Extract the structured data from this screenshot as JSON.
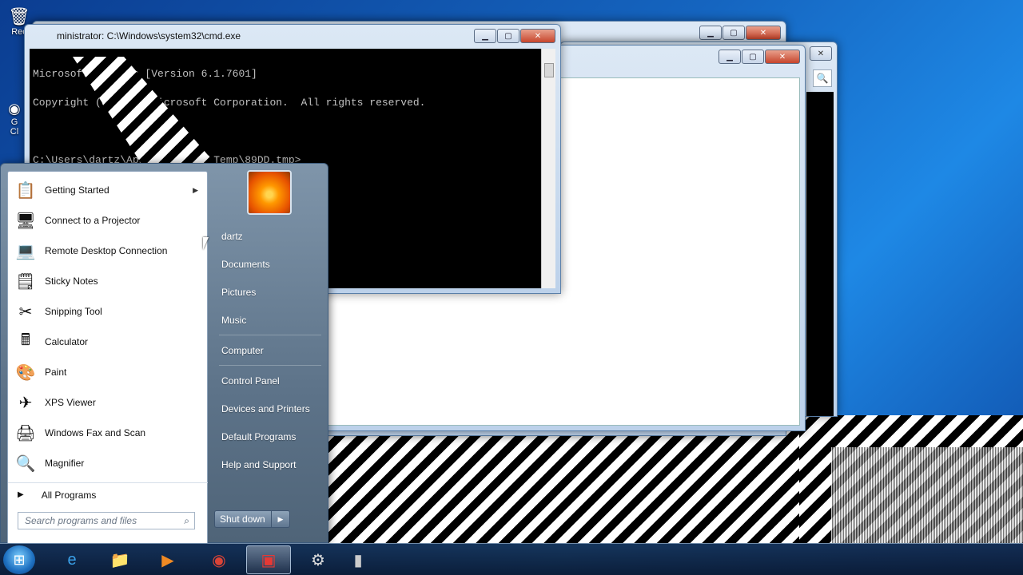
{
  "desktop": {
    "icon_recycle": "Rec",
    "icon_chrome": "G\nCl"
  },
  "cmd_window": {
    "title": "ministrator: C:\\Windows\\system32\\cmd.exe",
    "lines": [
      "Microsoft Windows [Version 6.1.7601]",
      "Copyright (c) 2009 Microsoft Corporation.  All rights reserved.",
      "",
      "C:\\Users\\dartz\\AppData\\Local\\Temp\\89DD.tmp>_"
    ]
  },
  "start_menu": {
    "programs": [
      {
        "label": "Getting Started",
        "icon": "getting-started-icon",
        "glyph": "📋",
        "submenu": true
      },
      {
        "label": "Connect to a Projector",
        "icon": "projector-icon",
        "glyph": "🖥"
      },
      {
        "label": "Remote Desktop Connection",
        "icon": "remote-desktop-icon",
        "glyph": "💻"
      },
      {
        "label": "Sticky Notes",
        "icon": "sticky-notes-icon",
        "glyph": "🗒"
      },
      {
        "label": "Snipping Tool",
        "icon": "snipping-tool-icon",
        "glyph": "✂"
      },
      {
        "label": "Calculator",
        "icon": "calculator-icon",
        "glyph": "🖩"
      },
      {
        "label": "Paint",
        "icon": "paint-icon",
        "glyph": "🎨"
      },
      {
        "label": "XPS Viewer",
        "icon": "xps-viewer-icon",
        "glyph": "✈"
      },
      {
        "label": "Windows Fax and Scan",
        "icon": "fax-scan-icon",
        "glyph": "🖨"
      },
      {
        "label": "Magnifier",
        "icon": "magnifier-icon",
        "glyph": "🔍"
      }
    ],
    "all_programs": "All Programs",
    "search_placeholder": "Search programs and files",
    "places": [
      "dartz",
      "Documents",
      "Pictures",
      "Music",
      "Computer",
      "Control Panel",
      "Devices and Printers",
      "Default Programs",
      "Help and Support"
    ],
    "shutdown": "Shut down"
  },
  "taskbar": {
    "items": [
      {
        "name": "internet-explorer",
        "glyph": "e",
        "color": "#3aa0e8"
      },
      {
        "name": "windows-explorer",
        "glyph": "📁",
        "color": "#f2c14e"
      },
      {
        "name": "media-player",
        "glyph": "▶",
        "color": "#f08a24"
      },
      {
        "name": "chrome",
        "glyph": "◉",
        "color": "#db4437"
      },
      {
        "name": "app-active",
        "glyph": "▣",
        "color": "#e53935"
      },
      {
        "name": "tool",
        "glyph": "⚙",
        "color": "#dddddd"
      },
      {
        "name": "cmd",
        "glyph": "▮",
        "color": "#cccccc"
      }
    ]
  },
  "colors": {
    "desktop": "#1565c0",
    "console_bg": "#000000",
    "console_fg": "#c0c0c0"
  }
}
